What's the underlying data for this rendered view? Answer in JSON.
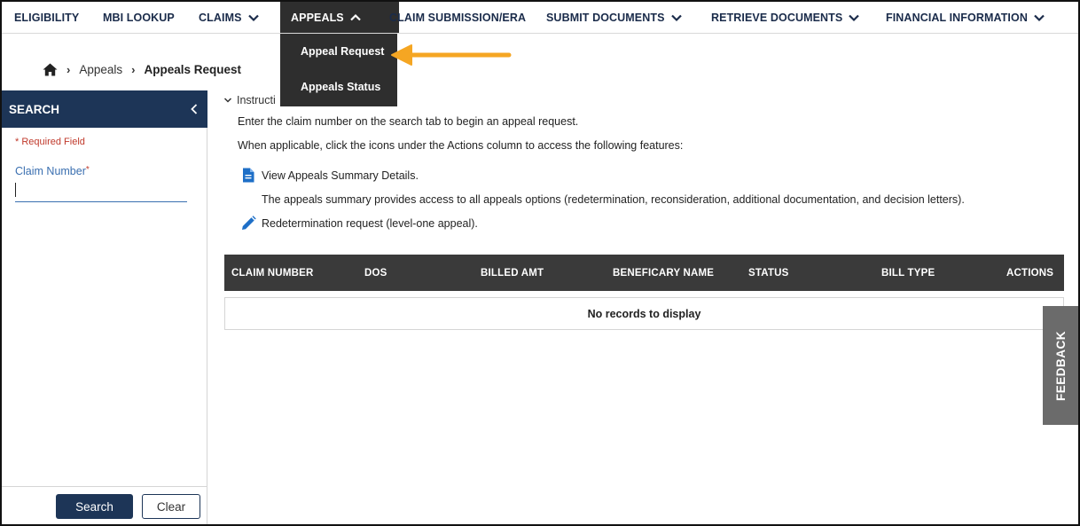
{
  "nav": {
    "items": [
      {
        "label": "ELIGIBILITY"
      },
      {
        "label": "MBI LOOKUP"
      },
      {
        "label": "CLAIMS"
      },
      {
        "label": "APPEALS"
      },
      {
        "label": "CLAIM SUBMISSION/ERA"
      },
      {
        "label": "SUBMIT DOCUMENTS"
      },
      {
        "label": "RETRIEVE DOCUMENTS"
      },
      {
        "label": "FINANCIAL INFORMATION"
      }
    ],
    "dropdown": {
      "items": [
        {
          "label": "Appeal Request"
        },
        {
          "label": "Appeals Status"
        }
      ]
    }
  },
  "breadcrumb": {
    "parent": "Appeals",
    "current": "Appeals Request"
  },
  "sidebar": {
    "title": "SEARCH",
    "required_note": "* Required Field",
    "claim_label": "Claim Number",
    "required_star": "*",
    "claim_value": "",
    "search_button": "Search",
    "clear_button": "Clear"
  },
  "instructions": {
    "toggle_label": "Instructi",
    "line1": "Enter the claim number on the search tab to begin an appeal request.",
    "line2": "When applicable, click the icons under the Actions column to access the following features:",
    "feature1": "View Appeals Summary Details.",
    "feature1_desc": "The appeals summary provides access to all appeals options (redetermination, reconsideration, additional documentation, and decision letters).",
    "feature2": "Redetermination request (level-one appeal)."
  },
  "table": {
    "columns": [
      "CLAIM NUMBER",
      "DOS",
      "BILLED AMT",
      "BENEFICARY NAME",
      "STATUS",
      "BILL TYPE",
      "ACTIONS"
    ],
    "empty_message": "No records to display"
  },
  "feedback": {
    "label": "FEEDBACK"
  },
  "colors": {
    "nav_active_bg": "#2e2e2e",
    "sidebar_header_bg": "#1d3557",
    "arrow": "#f5a623",
    "table_header_bg": "#3a3a3a",
    "feedback_bg": "#6b6b6b",
    "icon_blue": "#1e6fc7"
  }
}
